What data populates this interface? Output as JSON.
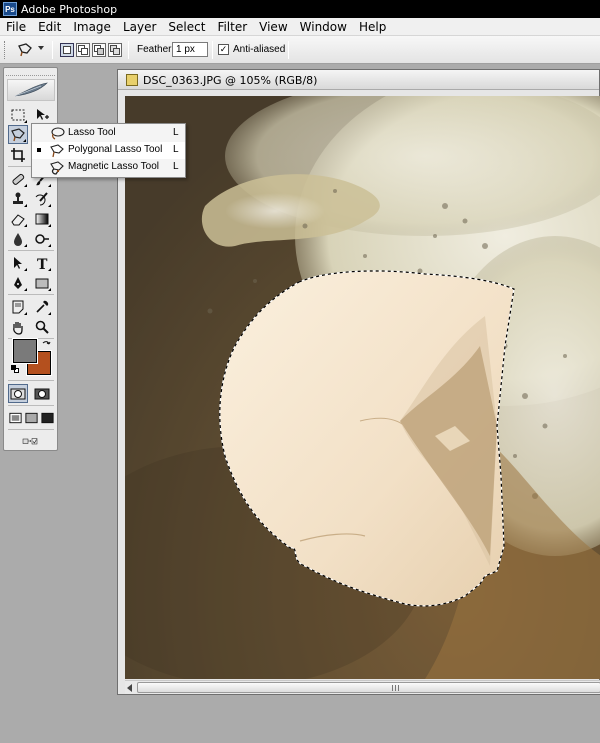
{
  "app": {
    "title": "Adobe Photoshop",
    "logo_icon": "photoshop-logo-icon"
  },
  "menu": {
    "items": [
      "File",
      "Edit",
      "Image",
      "Layer",
      "Select",
      "Filter",
      "View",
      "Window",
      "Help"
    ]
  },
  "options_bar": {
    "tool_icon": "polygonal-lasso-icon",
    "selection_modes": [
      "new-selection",
      "add-to-selection",
      "subtract-from-selection",
      "intersect-selection"
    ],
    "active_mode": "new-selection",
    "feather_label": "Feather:",
    "feather_value": "1 px",
    "anti_aliased_label": "Anti-aliased",
    "anti_aliased_checked": true
  },
  "toolbox": {
    "tools": [
      "rectangular-marquee",
      "move",
      "polygonal-lasso",
      "magic-wand",
      "crop",
      "slice",
      "healing-brush",
      "brush",
      "clone-stamp",
      "history-brush",
      "eraser",
      "gradient",
      "blur",
      "dodge",
      "path-selection",
      "type",
      "pen",
      "rectangle",
      "notes",
      "eyedropper",
      "hand",
      "zoom"
    ],
    "active_tool": "polygonal-lasso",
    "foreground_color": "#7a7a7a",
    "background_color": "#b4501e"
  },
  "flyout": {
    "items": [
      {
        "label": "Lasso Tool",
        "key": "L",
        "icon": "lasso-icon",
        "selected": false
      },
      {
        "label": "Polygonal Lasso Tool",
        "key": "L",
        "icon": "polygonal-lasso-icon",
        "selected": true
      },
      {
        "label": "Magnetic Lasso Tool",
        "key": "L",
        "icon": "magnetic-lasso-icon",
        "selected": false
      }
    ]
  },
  "document": {
    "title": "DSC_0363.JPG @ 105% (RGB/8)",
    "colors": {
      "background": "#5a4a34",
      "froth": "#e8e4cc",
      "shell": "#f3e4cf",
      "shadow": "#8a6a44"
    }
  }
}
